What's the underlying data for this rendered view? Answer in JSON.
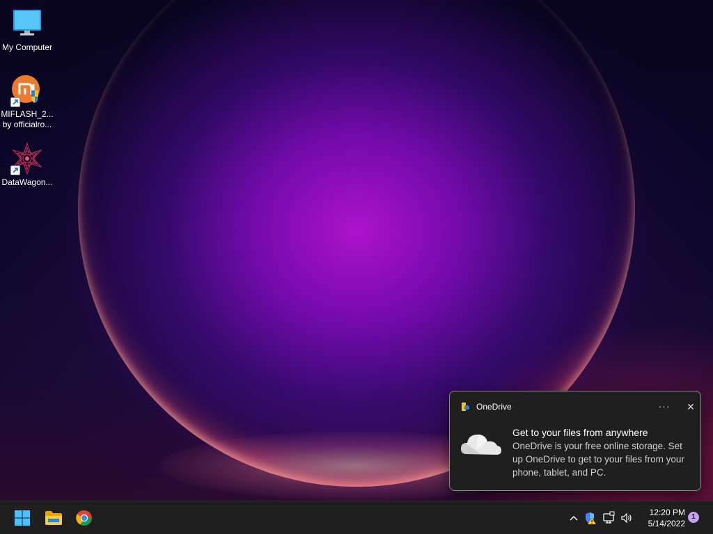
{
  "desktop": {
    "icons": [
      {
        "label": "My Computer",
        "icon": "monitor-icon"
      },
      {
        "label": "MIFLASH_2...\nby officialro...",
        "icon": "miflash-icon"
      },
      {
        "label": "DataWagon...",
        "icon": "datawagon-icon"
      }
    ]
  },
  "taskbar": {
    "start_icon": "windows-start-icon",
    "pinned": [
      {
        "name": "File Explorer",
        "icon": "folder-icon"
      },
      {
        "name": "Google Chrome",
        "icon": "chrome-icon"
      }
    ],
    "tray": {
      "time": "12:20 PM",
      "date": "5/14/2022",
      "notification_count": "1"
    }
  },
  "toast": {
    "app_name": "OneDrive",
    "more_label": "···",
    "close_label": "✕",
    "title": "Get to your files from anywhere",
    "body": "OneDrive is your free online storage. Set up OneDrive to get to your files from your phone, tablet, and PC."
  },
  "colors": {
    "taskbar": "#1f1f1f",
    "toast_bg": "#1f1f1f",
    "accent_badge": "#c7a0f0"
  }
}
